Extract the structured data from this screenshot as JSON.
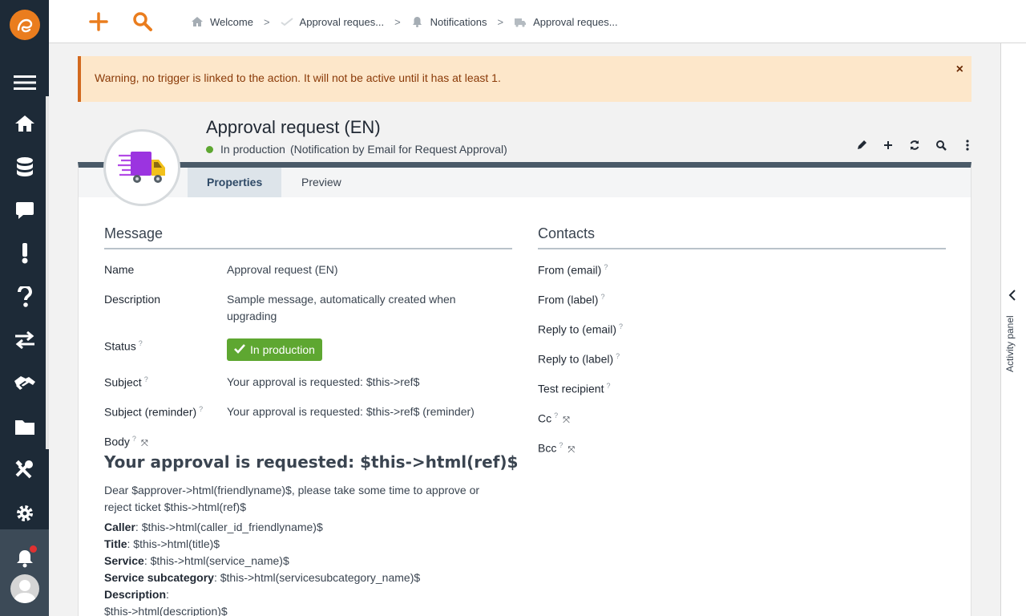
{
  "topbar": {
    "breadcrumbs": [
      {
        "label": "Welcome",
        "icon": "home-icon"
      },
      {
        "label": "Approval reques...",
        "icon": "approval-icon"
      },
      {
        "label": "Notifications",
        "icon": "bell-icon"
      },
      {
        "label": "Approval reques...",
        "icon": "truck-icon"
      }
    ]
  },
  "warning": {
    "text": "Warning, no trigger is linked to the action. It will not be active until it has at least 1.",
    "close": "×"
  },
  "object": {
    "title": "Approval request (EN)",
    "status": "In production",
    "subtitle": "(Notification by Email for Request Approval)"
  },
  "tabs": [
    "Properties",
    "Preview"
  ],
  "message": {
    "title": "Message",
    "name_label": "Name",
    "name_value": "Approval request (EN)",
    "description_label": "Description",
    "description_value": "Sample message, automatically created when upgrading",
    "status_label": "Status",
    "status_value": "In production",
    "subject_label": "Subject",
    "subject_value": "Your approval is requested: $this->ref$",
    "subject_reminder_label": "Subject (reminder)",
    "subject_reminder_value": "Your approval is requested: $this->ref$ (reminder)",
    "body_label": "Body",
    "body_heading": "Your approval is requested: $this->html(ref)$",
    "body_intro": "Dear $approver->html(friendlyname)$, please take some time to approve or reject ticket $this->html(ref)$",
    "body_fields": [
      {
        "label": "Caller",
        "value": ": $this->html(caller_id_friendlyname)$"
      },
      {
        "label": "Title",
        "value": ": $this->html(title)$"
      },
      {
        "label": "Service",
        "value": ": $this->html(service_name)$"
      },
      {
        "label": "Service subcategory",
        "value": ": $this->html(servicesubcategory_name)$"
      },
      {
        "label": "Description",
        "value": ":"
      }
    ],
    "body_tail": "$this->html(description)$"
  },
  "contacts": {
    "title": "Contacts",
    "fields": [
      "From (email)",
      "From (label)",
      "Reply to (email)",
      "Reply to (label)",
      "Test recipient",
      "Cc",
      "Bcc"
    ]
  },
  "activity_panel": {
    "label": "Activity panel"
  },
  "colors": {
    "accent": "#ea7d1e",
    "sidebar": "#1d2a37",
    "status_green": "#5ea731",
    "warning_bg": "#fde7ca"
  }
}
